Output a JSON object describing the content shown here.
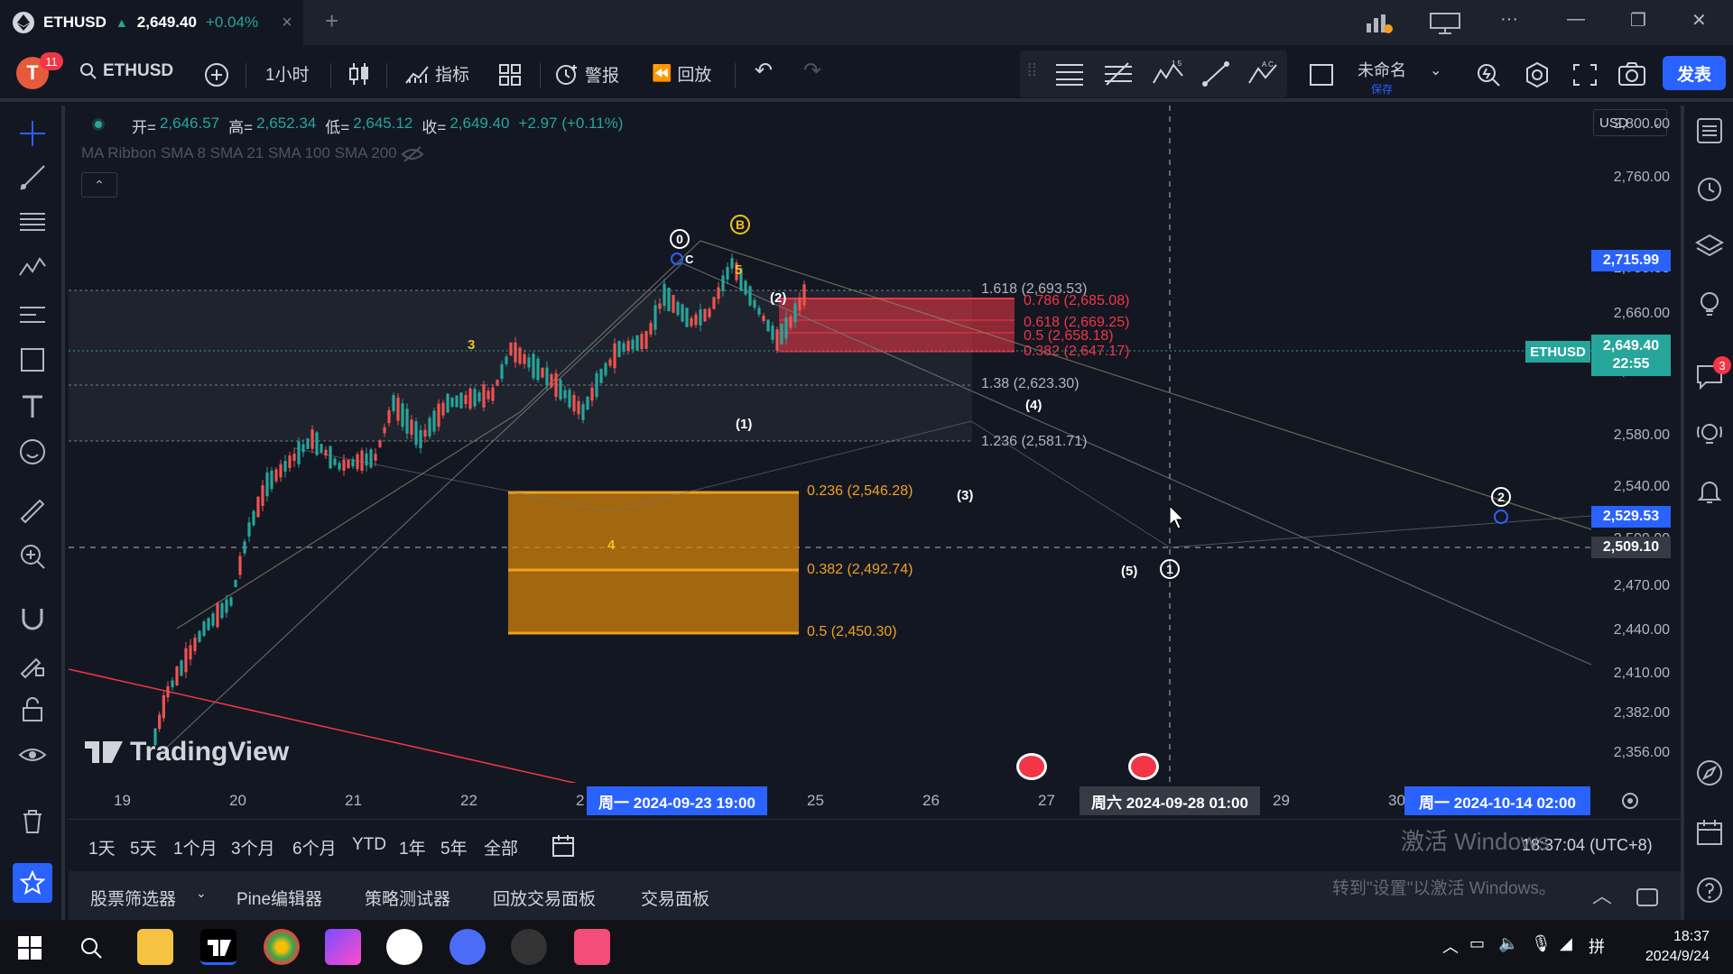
{
  "tab": {
    "symbol": "ETHUSD",
    "price": "2,649.40",
    "change": "+0.04%",
    "close": "×",
    "new_tab": "+"
  },
  "toolbar": {
    "avatar_letter": "T",
    "notifications": "11",
    "symbol": "ETHUSD",
    "interval": "1小时",
    "indicators": "指标",
    "alerts": "警报",
    "replay": "回放",
    "layout_name": "未命名",
    "layout_saved": "保存",
    "publish": "发表"
  },
  "legend": {
    "open_label": "开=",
    "open": "2,646.57",
    "high_label": "高=",
    "high": "2,652.34",
    "low_label": "低=",
    "low": "2,645.12",
    "close_label": "收=",
    "close": "2,649.40",
    "change": "+2.97 (+0.11%)",
    "indicator": "MA Ribbon SMA 8 SMA 21 SMA 100 SMA 200"
  },
  "currency": "USD",
  "price_axis": {
    "labels": [
      "2,800.00",
      "2,760.00",
      "2,700.00",
      "2,660.00",
      "2,620.00",
      "2,580.00",
      "2,540.00",
      "2,500.00",
      "2,470.00",
      "2,440.00",
      "2,410.00",
      "2,382.00",
      "2,356.00"
    ],
    "badge_top": "2,715.99",
    "badge_symbol": "ETHUSD",
    "badge_current": "2,649.40",
    "badge_countdown": "22:55",
    "badge_blue": "2,529.53",
    "badge_crosshair": "2,509.10"
  },
  "time_axis": {
    "labels": [
      "19",
      "20",
      "21",
      "22",
      "2",
      "25",
      "26",
      "27",
      "29",
      "30"
    ],
    "badge1": "周一 2024-09-23   19:00",
    "badge2": "周六 2024-09-28   01:00",
    "badge3": "周一 2024-10-14   02:00"
  },
  "fib_upper": {
    "l1618": "1.618 (2,693.53)",
    "l0786": "0.786 (2,685.08)",
    "l0618": "0.618 (2,669.25)",
    "l05": "0.5 (2,658.18)",
    "l0382": "0.382 (2,647.17)",
    "l138": "1.38 (2,623.30)",
    "l1236": "1.236 (2,581.71)"
  },
  "fib_lower": {
    "l0236": "0.236 (2,546.28)",
    "l0382": "0.382 (2,492.74)",
    "l05": "0.5 (2,450.30)"
  },
  "waves": {
    "w0": "0",
    "wB": "B",
    "wC": "C",
    "w5": "5",
    "w3": "3",
    "w4": "4",
    "p1": "(1)",
    "p2": "(2)",
    "p3": "(3)",
    "p4": "(4)",
    "p5": "(5)",
    "c1": "1",
    "c2": "2"
  },
  "watermark": "TradingView",
  "range_buttons": [
    "1天",
    "5天",
    "1个月",
    "3个月",
    "6个月",
    "YTD",
    "1年",
    "5年",
    "全部"
  ],
  "clock": "18:37:04 (UTC+8)",
  "windows_activation": {
    "title": "激活 Windows",
    "subtitle": "转到\"设置\"以激活 Windows。"
  },
  "bottom_tabs": [
    "股票筛选器",
    "Pine编辑器",
    "策略测试器",
    "回放交易面板",
    "交易面板"
  ],
  "right_badge": "3",
  "taskbar": {
    "time": "18:37",
    "date": "2024/9/24"
  },
  "colors": {
    "background": "#131722",
    "accent": "#2962ff",
    "up": "#26a69a",
    "down": "#ef5350",
    "fib_orange": "#f0a020",
    "fib_red": "#f23645"
  }
}
